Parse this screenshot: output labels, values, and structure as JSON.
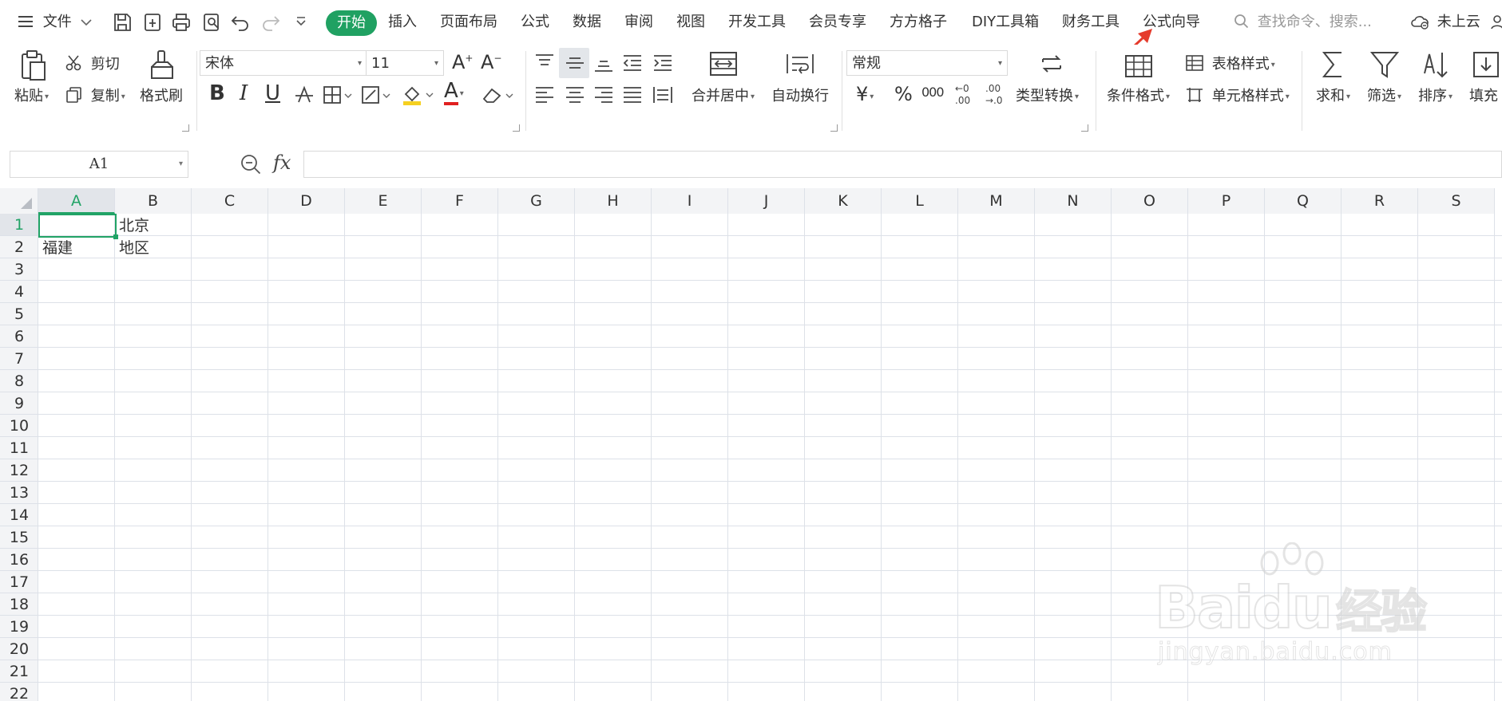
{
  "menubar": {
    "file": "文件",
    "tabs": [
      "开始",
      "插入",
      "页面布局",
      "公式",
      "数据",
      "审阅",
      "视图",
      "开发工具",
      "会员专享",
      "方方格子",
      "DIY工具箱",
      "财务工具",
      "公式向导"
    ],
    "search_placeholder": "查找命令、搜索...",
    "cloud_status": "未上云"
  },
  "ribbon": {
    "paste": "粘贴",
    "cut": "剪切",
    "copy": "复制",
    "format_painter": "格式刷",
    "font_name": "宋体",
    "font_size": "11",
    "merge_center": "合并居中",
    "wrap_text": "自动换行",
    "number_format": "常规",
    "type_convert": "类型转换",
    "cond_format": "条件格式",
    "table_style": "表格样式",
    "cell_style": "单元格样式",
    "sum": "求和",
    "filter": "筛选",
    "sort": "排序",
    "fill": "填充",
    "bold": "B",
    "italic": "I",
    "underline": "U",
    "font_color_letter": "A",
    "currency": "¥",
    "percent": "%",
    "thousands": "000"
  },
  "formula_bar": {
    "cell_ref": "A1",
    "fx": "fx",
    "value": ""
  },
  "sheet": {
    "columns": [
      "A",
      "B",
      "C",
      "D",
      "E",
      "F",
      "G",
      "H",
      "I",
      "J",
      "K",
      "L",
      "M",
      "N",
      "O",
      "P",
      "Q",
      "R",
      "S"
    ],
    "rows": [
      "1",
      "2",
      "3",
      "4",
      "5",
      "6",
      "7",
      "8",
      "9",
      "10",
      "11",
      "12",
      "13",
      "14",
      "15",
      "16",
      "17",
      "18",
      "19",
      "20",
      "21",
      "22"
    ],
    "cells": {
      "B1": "北京",
      "A2": "福建",
      "B2": "地区"
    },
    "selected": "A1"
  },
  "watermark": {
    "brand": "Bai",
    "brand2": "du",
    "cn": "经验",
    "url": "jingyan.baidu.com"
  },
  "colors": {
    "accent": "#20a162",
    "selection": "#21a366",
    "arrow": "#e53b2c"
  }
}
